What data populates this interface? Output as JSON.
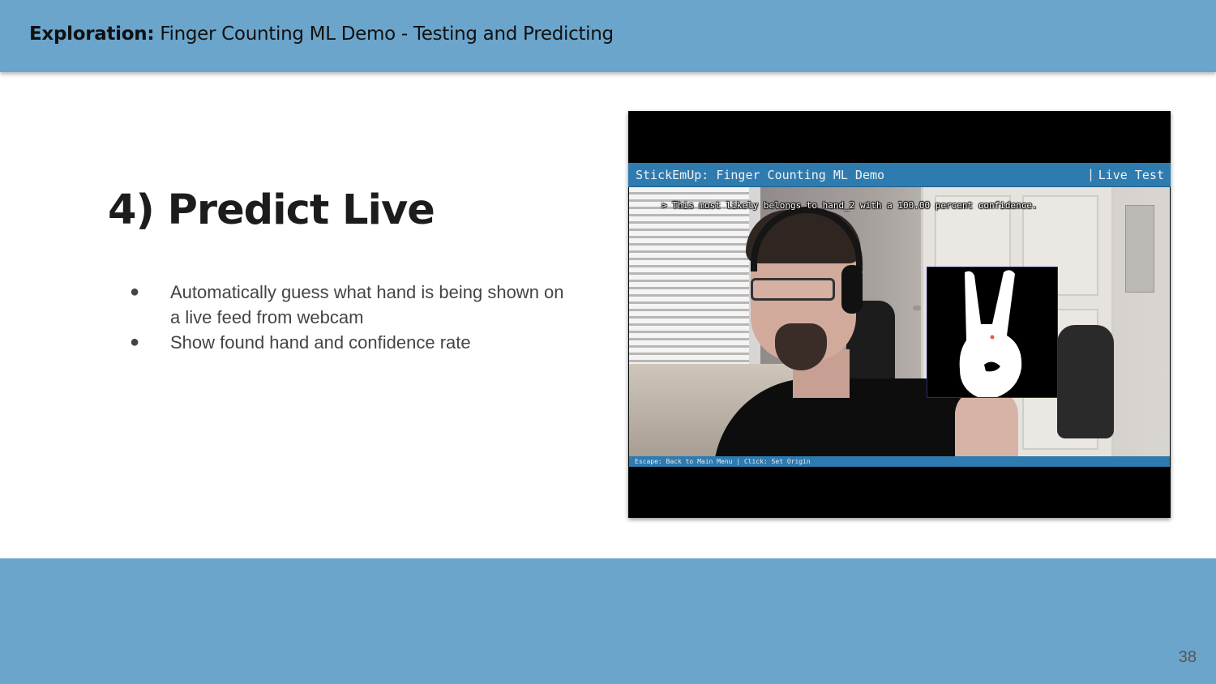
{
  "header": {
    "label_bold": "Exploration:",
    "title": "Finger Counting ML Demo - Testing and Predicting",
    "background_color": "#6ba5cb"
  },
  "slide": {
    "title": "4) Predict Live",
    "bullets": [
      {
        "symbol": "●",
        "text": "Automatically guess what hand is being shown on a live feed from webcam"
      },
      {
        "symbol": "●",
        "text": "Show found hand and confidence rate"
      }
    ]
  },
  "screenshot": {
    "app_title": "StickEmUp: Finger Counting ML Demo",
    "separator": "|",
    "mode": "Live Test",
    "prediction_text": "> This most likely belongs to hand_2 with a 100.00 percent confidence.",
    "status_bar": "Escape: Back to Main Menu  |  Click: Set Origin",
    "accent_color": "#2e7bb0"
  },
  "footer": {
    "page_number": "38",
    "background_color": "#6ba5cb"
  }
}
